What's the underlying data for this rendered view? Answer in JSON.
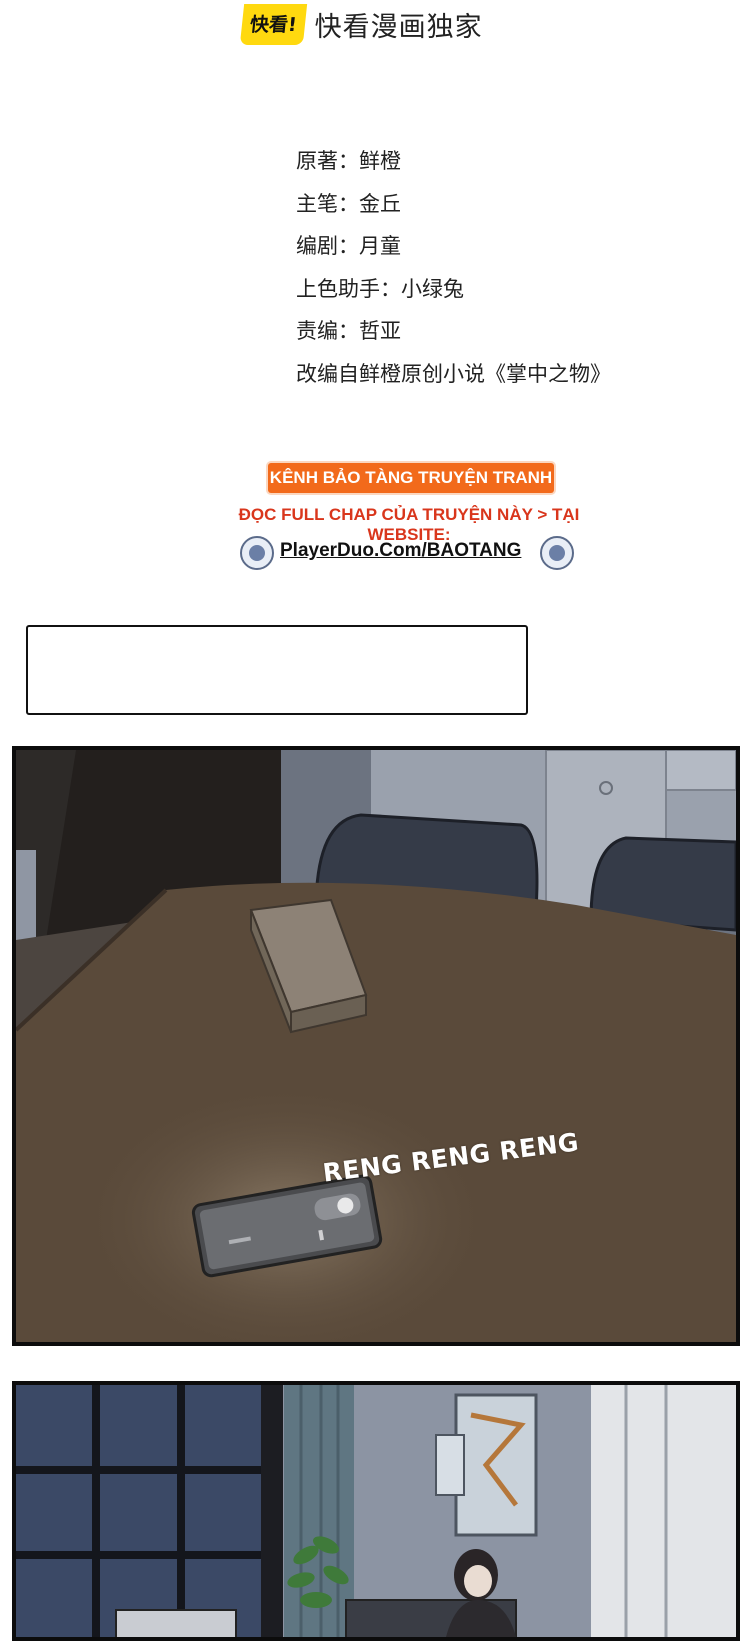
{
  "header": {
    "logo_badge": "快看!",
    "logo_text": "快看漫画独家"
  },
  "credits": [
    "原著：鲜橙",
    "主笔：金丘",
    "编剧：月童",
    "上色助手：小绿兔",
    "责编：哲亚",
    "改编自鲜橙原创小说《掌中之物》"
  ],
  "watermark": {
    "tag": "KÊNH BẢO TÀNG TRUYỆN TRANH",
    "line": "ĐỌC FULL CHAP CỦA TRUYỆN NÀY > TẠI WEBSITE:",
    "url": "PlayerDuo.Com/BAOTANG"
  },
  "panel1": {
    "sfx": "RENG RENG RENG"
  },
  "colors": {
    "logo_yellow": "#ffd90f",
    "watermark_orange": "#f26a1b",
    "watermark_red": "#d9361c",
    "table_brown": "#5a4a3a",
    "wall_grey": "#7f8794",
    "night_blue": "#3b4966"
  }
}
